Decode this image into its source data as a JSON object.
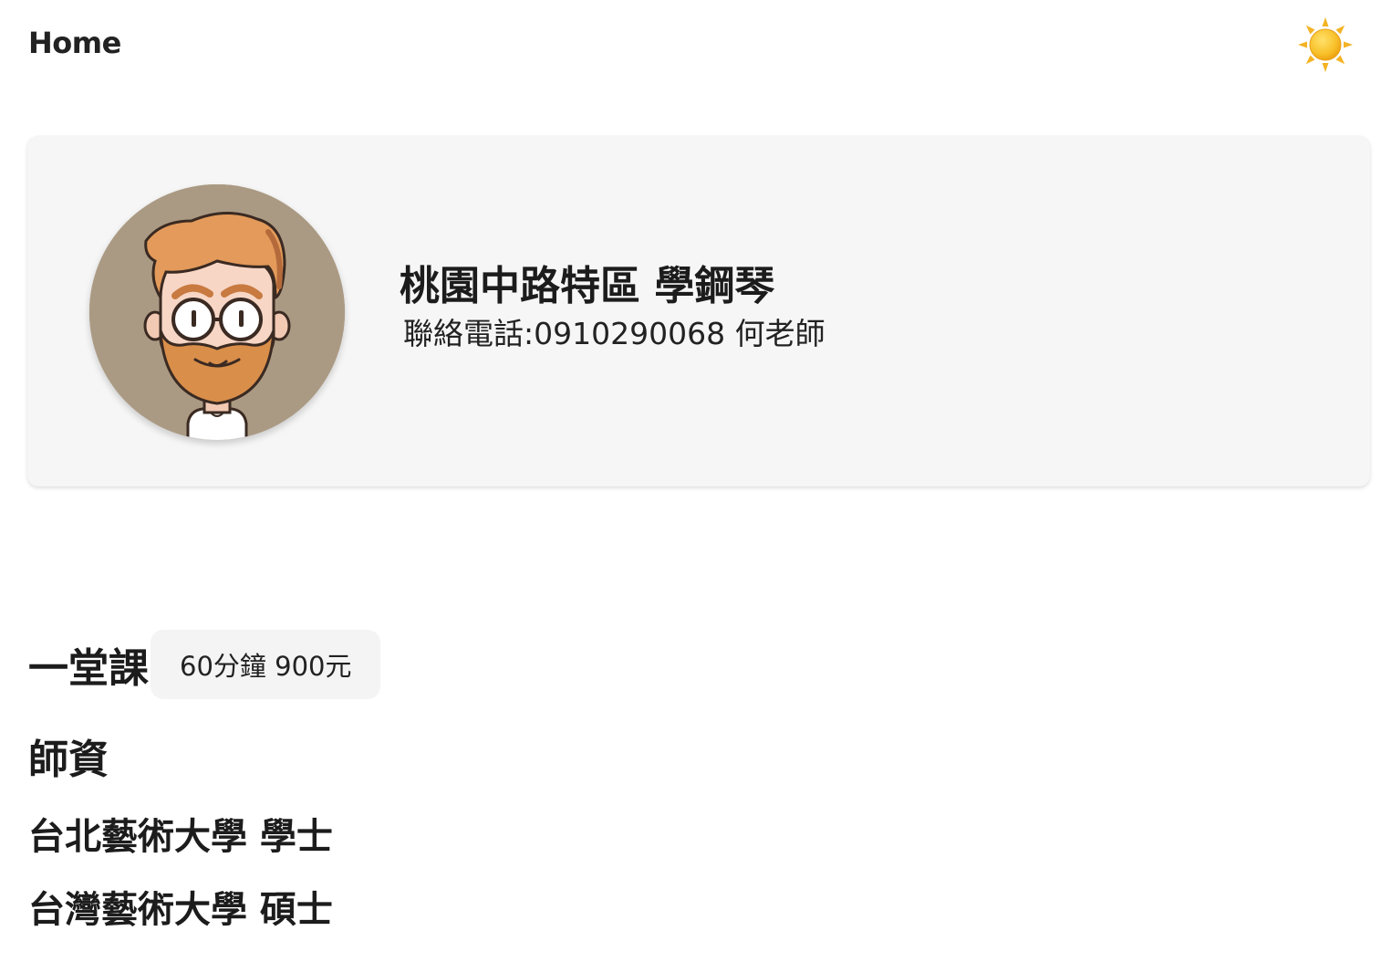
{
  "header": {
    "home_label": "Home",
    "theme_icon": "sun-icon"
  },
  "profile": {
    "avatar_icon": "bearded-man-avatar",
    "title": "桃園中路特區 學鋼琴",
    "phone": "聯絡電話:0910290068 何老師"
  },
  "lesson": {
    "label": "一堂課",
    "price": "60分鐘 900元"
  },
  "credentials": {
    "heading": "師資",
    "items": [
      "台北藝術大學 學士",
      "台灣藝術大學 碩士"
    ]
  },
  "colors": {
    "card_bg": "#f6f6f6",
    "avatar_bg": "#ab9a83",
    "sun": "#f5b51f"
  }
}
